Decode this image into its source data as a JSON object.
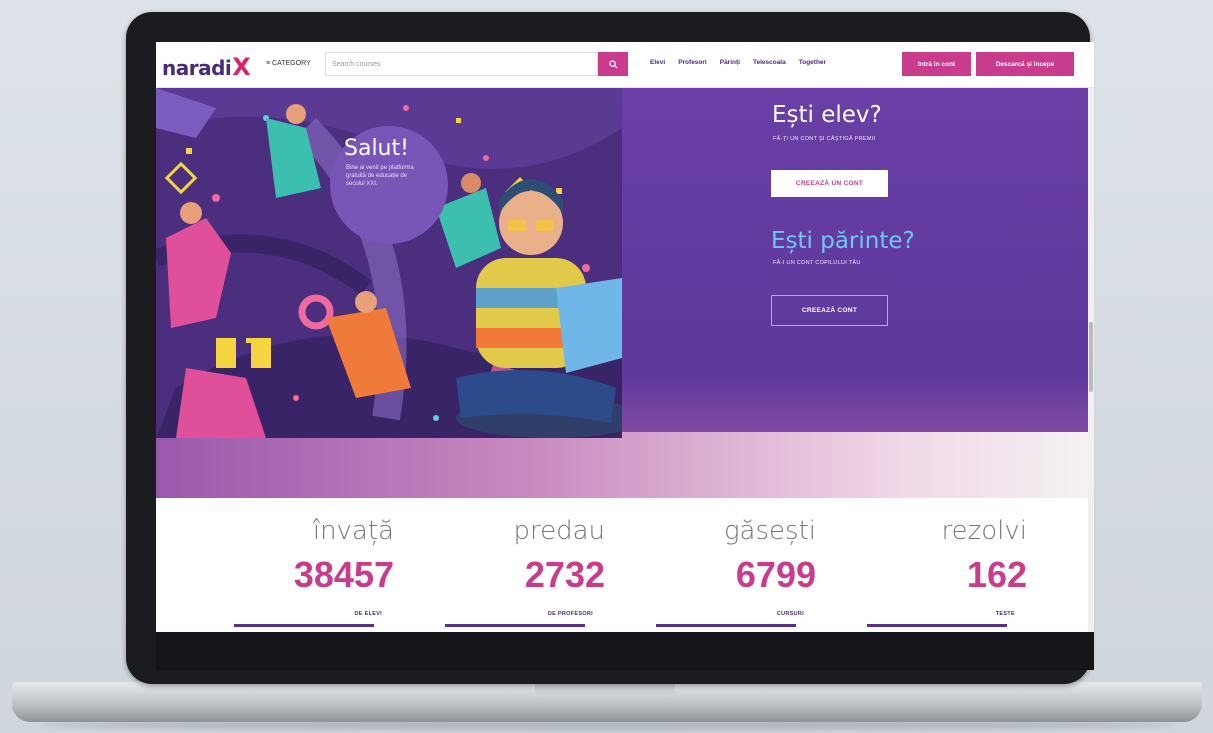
{
  "navbar": {
    "logo_text": "naradi",
    "logo_x": "X",
    "category_label": "≡ CATEGORY",
    "search_placeholder": "Search courses",
    "links": [
      "Elevi",
      "Profesori",
      "Părinți",
      "Telescoala",
      "Together"
    ],
    "login_label": "Intră în cont",
    "signup_label": "Descarcă și începe"
  },
  "hero": {
    "salut_title": "Salut!",
    "salut_text": "Bine ai venit pe platforma gratuită de educație de secolul XXI.",
    "student_title": "Ești elev?",
    "student_sub": "FĂ-ȚI UN CONT ȘI CÂȘTIGĂ PREMII",
    "student_button": "CREEAZĂ UN CONT",
    "parent_title": "Ești părinte?",
    "parent_sub": "FĂ-I UN CONT COPILULUI TĂU",
    "parent_button": "CREEAZĂ CONT"
  },
  "stats": [
    {
      "verb": "învață",
      "number": "38457",
      "label": "DE ELEVI"
    },
    {
      "verb": "predau",
      "number": "2732",
      "label": "DE PROFESORI"
    },
    {
      "verb": "găsești",
      "number": "6799",
      "label": "CURSURI"
    },
    {
      "verb": "rezolvi",
      "number": "162",
      "label": "TESTE"
    }
  ],
  "colors": {
    "brand_purple": "#5e389b",
    "accent_pink": "#c93b8d",
    "accent_blue": "#6ec8f2"
  },
  "icons": {
    "search": "search-icon",
    "menu": "menu-icon"
  }
}
